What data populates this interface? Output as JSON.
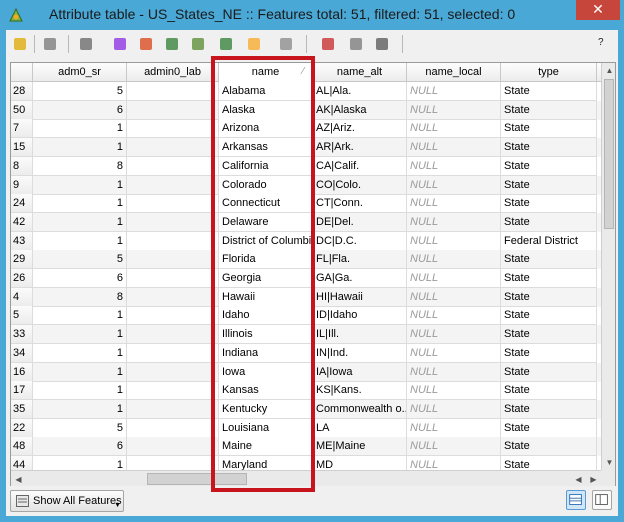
{
  "window": {
    "title": "Attribute table - US_States_NE :: Features total: 51, filtered: 51, selected: 0",
    "close_glyph": "✕"
  },
  "toolbar": {
    "buttons": [
      {
        "icon": "pencil-icon",
        "name": "toggle-editing-button"
      },
      {
        "icon": "save-icon",
        "name": "save-edits-button"
      },
      {
        "icon": "trash-icon",
        "name": "delete-selected-button"
      },
      {
        "icon": "expression-icon",
        "name": "select-by-expression-button"
      },
      {
        "icon": "deselect-icon",
        "name": "deselect-all-button"
      },
      {
        "icon": "move-selection-top-icon",
        "name": "move-selection-top-button"
      },
      {
        "icon": "invert-selection-icon",
        "name": "invert-selection-button"
      },
      {
        "icon": "pan-to-selection-icon",
        "name": "pan-to-selection-button"
      },
      {
        "icon": "zoom-to-selection-icon",
        "name": "zoom-to-selection-button"
      },
      {
        "icon": "copy-rows-icon",
        "name": "copy-rows-button"
      },
      {
        "icon": "delete-column-icon",
        "name": "delete-column-button"
      },
      {
        "icon": "new-column-icon",
        "name": "new-column-button"
      },
      {
        "icon": "field-calculator-icon",
        "name": "field-calculator-button"
      }
    ],
    "help": "?"
  },
  "table": {
    "columns": [
      "adm0_sr",
      "admin0_lab",
      "name",
      "name_alt",
      "name_local",
      "type"
    ],
    "sort_indicator": "⁄",
    "rows": [
      {
        "id": "28",
        "adm0_sr": "5",
        "name": "Alabama",
        "name_alt": "AL|Ala.",
        "name_local": "NULL",
        "type": "State"
      },
      {
        "id": "50",
        "adm0_sr": "6",
        "name": "Alaska",
        "name_alt": "AK|Alaska",
        "name_local": "NULL",
        "type": "State"
      },
      {
        "id": "7",
        "adm0_sr": "1",
        "name": "Arizona",
        "name_alt": "AZ|Ariz.",
        "name_local": "NULL",
        "type": "State"
      },
      {
        "id": "15",
        "adm0_sr": "1",
        "name": "Arkansas",
        "name_alt": "AR|Ark.",
        "name_local": "NULL",
        "type": "State"
      },
      {
        "id": "8",
        "adm0_sr": "8",
        "name": "California",
        "name_alt": "CA|Calif.",
        "name_local": "NULL",
        "type": "State"
      },
      {
        "id": "9",
        "adm0_sr": "1",
        "name": "Colorado",
        "name_alt": "CO|Colo.",
        "name_local": "NULL",
        "type": "State"
      },
      {
        "id": "24",
        "adm0_sr": "1",
        "name": "Connecticut",
        "name_alt": "CT|Conn.",
        "name_local": "NULL",
        "type": "State"
      },
      {
        "id": "42",
        "adm0_sr": "1",
        "name": "Delaware",
        "name_alt": "DE|Del.",
        "name_local": "NULL",
        "type": "State"
      },
      {
        "id": "43",
        "adm0_sr": "1",
        "name": "District of Columbia",
        "name_alt": "DC|D.C.",
        "name_local": "NULL",
        "type": "Federal District"
      },
      {
        "id": "29",
        "adm0_sr": "5",
        "name": "Florida",
        "name_alt": "FL|Fla.",
        "name_local": "NULL",
        "type": "State"
      },
      {
        "id": "26",
        "adm0_sr": "6",
        "name": "Georgia",
        "name_alt": "GA|Ga.",
        "name_local": "NULL",
        "type": "State"
      },
      {
        "id": "4",
        "adm0_sr": "8",
        "name": "Hawaii",
        "name_alt": "HI|Hawaii",
        "name_local": "NULL",
        "type": "State"
      },
      {
        "id": "5",
        "adm0_sr": "1",
        "name": "Idaho",
        "name_alt": "ID|Idaho",
        "name_local": "NULL",
        "type": "State"
      },
      {
        "id": "33",
        "adm0_sr": "1",
        "name": "Illinois",
        "name_alt": "IL|Ill.",
        "name_local": "NULL",
        "type": "State"
      },
      {
        "id": "34",
        "adm0_sr": "1",
        "name": "Indiana",
        "name_alt": "IN|Ind.",
        "name_local": "NULL",
        "type": "State"
      },
      {
        "id": "16",
        "adm0_sr": "1",
        "name": "Iowa",
        "name_alt": "IA|Iowa",
        "name_local": "NULL",
        "type": "State"
      },
      {
        "id": "17",
        "adm0_sr": "1",
        "name": "Kansas",
        "name_alt": "KS|Kans.",
        "name_local": "NULL",
        "type": "State"
      },
      {
        "id": "35",
        "adm0_sr": "1",
        "name": "Kentucky",
        "name_alt": "Commonwealth o...",
        "name_local": "NULL",
        "type": "State"
      },
      {
        "id": "22",
        "adm0_sr": "5",
        "name": "Louisiana",
        "name_alt": "LA",
        "name_local": "NULL",
        "type": "State"
      },
      {
        "id": "48",
        "adm0_sr": "6",
        "name": "Maine",
        "name_alt": "ME|Maine",
        "name_local": "NULL",
        "type": "State"
      },
      {
        "id": "44",
        "adm0_sr": "1",
        "name": "Maryland",
        "name_alt": "MD",
        "name_local": "NULL",
        "type": "State"
      }
    ]
  },
  "bottom": {
    "filter_button": "Show All Features"
  }
}
